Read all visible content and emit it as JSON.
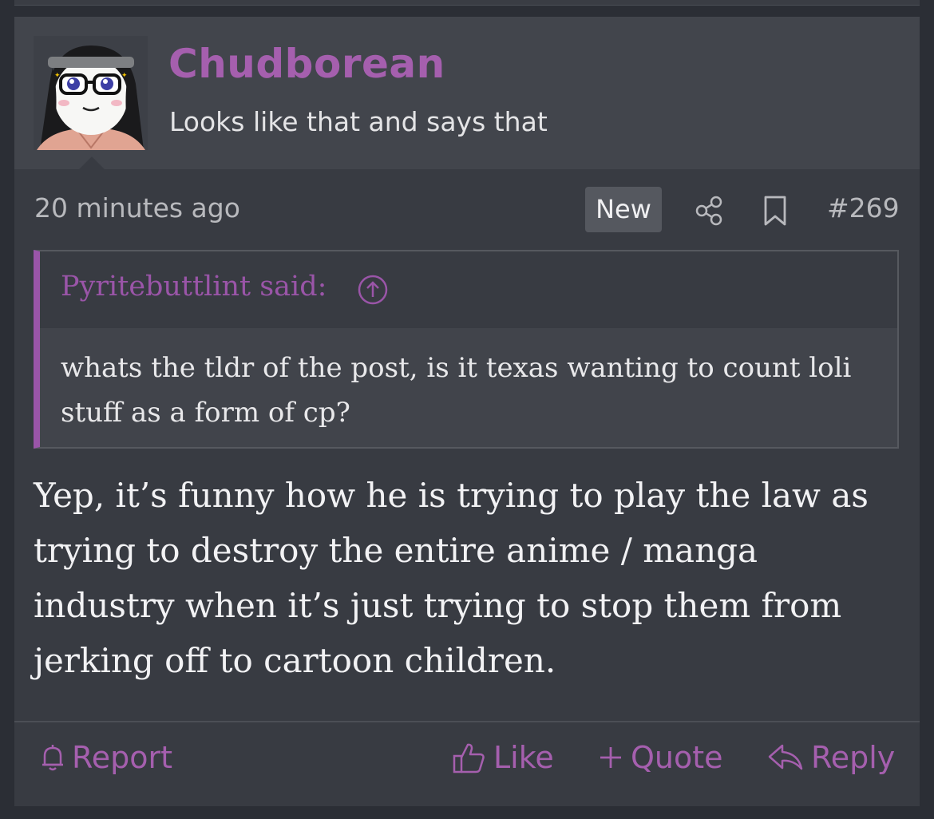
{
  "post": {
    "username": "Chudborean",
    "user_title": "Looks like that and says that",
    "time": "20 minutes ago",
    "badge": "New",
    "post_number": "#269",
    "quote": {
      "author": "Pyritebuttlint said:",
      "text": "whats the tldr of the post, is it texas wanting to count loli stuff as a form of cp?"
    },
    "message": "Yep, it’s funny how he is trying to play the law as trying to destroy the entire anime / manga industry when it’s just trying to stop them from jerking off to cartoon children."
  },
  "actions": {
    "report": "Report",
    "like": "Like",
    "quote": "Quote",
    "reply": "Reply"
  },
  "colors": {
    "accent": "#a55fae",
    "background": "#383b42",
    "header": "#42454c"
  },
  "icons": [
    "share-icon",
    "bookmark-icon",
    "arrow-up-circle-icon",
    "bell-icon",
    "thumbs-up-icon",
    "plus-icon",
    "reply-icon"
  ]
}
